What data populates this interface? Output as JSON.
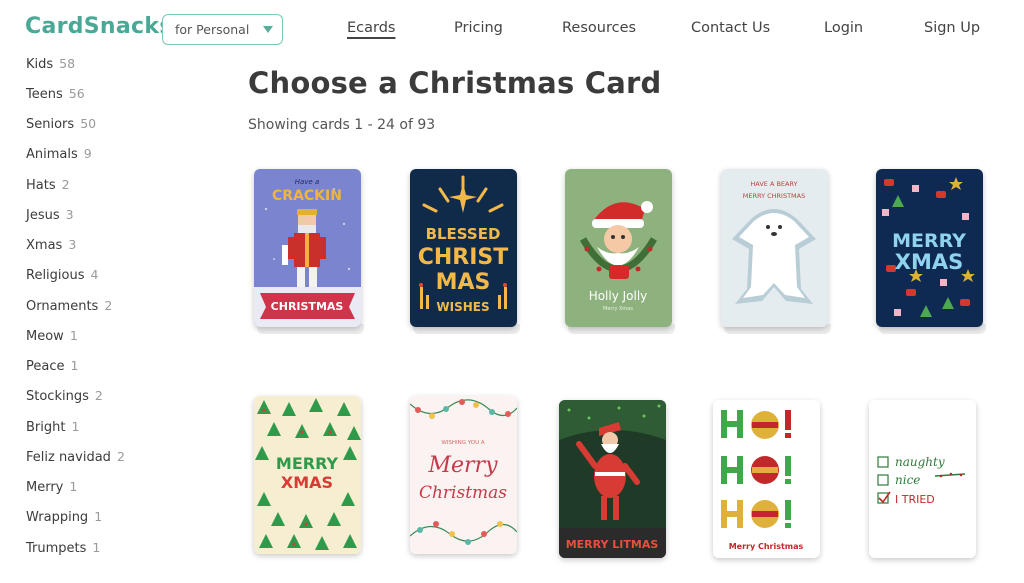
{
  "header": {
    "logo": "CardSnacks",
    "select_value": "for Personal",
    "nav": [
      {
        "label": "Ecards",
        "active": true
      },
      {
        "label": "Pricing"
      },
      {
        "label": "Resources"
      },
      {
        "label": "Contact Us"
      },
      {
        "label": "Login"
      },
      {
        "label": "Sign Up"
      }
    ]
  },
  "sidebar": {
    "items": [
      {
        "label": "Kids",
        "count": "58"
      },
      {
        "label": "Teens",
        "count": "56"
      },
      {
        "label": "Seniors",
        "count": "50"
      },
      {
        "label": "Animals",
        "count": "9"
      },
      {
        "label": "Hats",
        "count": "2"
      },
      {
        "label": "Jesus",
        "count": "3"
      },
      {
        "label": "Xmas",
        "count": "3"
      },
      {
        "label": "Religious",
        "count": "4"
      },
      {
        "label": "Ornaments",
        "count": "2"
      },
      {
        "label": "Meow",
        "count": "1"
      },
      {
        "label": "Peace",
        "count": "1"
      },
      {
        "label": "Stockings",
        "count": "2"
      },
      {
        "label": "Bright",
        "count": "1"
      },
      {
        "label": "Feliz navidad",
        "count": "2"
      },
      {
        "label": "Merry",
        "count": "1"
      },
      {
        "label": "Wrapping",
        "count": "1"
      },
      {
        "label": "Trumpets",
        "count": "1"
      }
    ]
  },
  "main": {
    "title": "Choose a Christmas Card",
    "subtitle": "Showing cards 1 - 24 of 93"
  },
  "cards": {
    "c1": {
      "line1": "Have a",
      "line2": "CRACKIN",
      "line3": "CHRISTMAS"
    },
    "c2": {
      "line1": "BLESSED",
      "line2": "CHRIST",
      "line3": "MAS",
      "line4": "WISHES"
    },
    "c3": {
      "line1": "Holly Jolly",
      "line2": "Merry Xmas"
    },
    "c4": {
      "line1": "HAVE A BEARY",
      "line2": "MERRY CHRISTMAS"
    },
    "c5": {
      "line1": "MERRY",
      "line2": "XMAS"
    },
    "c6": {
      "line1": "MERRY",
      "line2": "XMAS"
    },
    "c7": {
      "line1": "WISHING YOU A",
      "line2": "Merry",
      "line3": "Christmas"
    },
    "c8": {
      "line1": "MERRY LITMAS"
    },
    "c9": {
      "line1": "Merry Christmas"
    },
    "c10": {
      "line1": "naughty",
      "line2": "nice",
      "line3": "I TRIED"
    }
  },
  "colors": {
    "brand": "#4aa896",
    "select_border": "#7cc7b5"
  }
}
